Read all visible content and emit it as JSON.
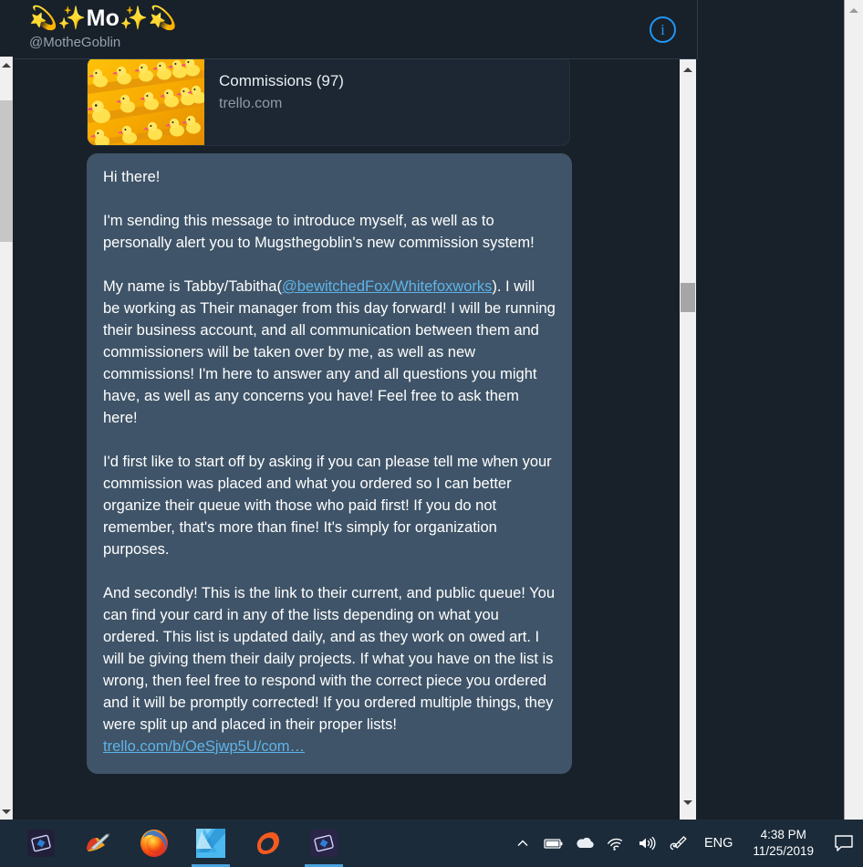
{
  "window": {
    "background_color": "#182029",
    "bubble_color": "#3f5468",
    "accent_color": "#2196f3",
    "link_color": "#5fb3e8"
  },
  "header": {
    "display_name": "Mo",
    "emoji_left": "💫✨",
    "emoji_right": "✨💫",
    "handle": "@MotheGoblin",
    "info_glyph": "i",
    "info_label": "Conversation info"
  },
  "link_preview": {
    "title": "Commissions (97)",
    "domain": "trello.com",
    "thumbnail_alt": "rows of yellow rubber ducks"
  },
  "message": {
    "paragraphs": [
      "Hi there!",
      "I'm sending this message to introduce myself, as well as to personally alert you to Mugsthegoblin's new commission system!",
      "I'd first like to start off by asking if you can please tell me when your commission was placed and what you ordered so I can better organize their queue with those who paid first! If you do not remember, that's more than fine! It's simply for organization purposes."
    ],
    "name_para_prefix": "My name is Tabby/Tabitha(",
    "name_para_link": "@bewitchedFox/Whitefoxworks",
    "name_para_suffix": "). I will be working as Their manager from this day forward! I will be running their business account, and all communication between them and commissioners will be taken over by me, as well as new commissions! I'm here to answer any and all questions you might have, as well as any concerns you have! Feel free to ask them here!",
    "final_para": "And secondly! This is the link to their current, and public queue! You can find your card in any of the lists depending on what you ordered. This list is updated daily, and as they work on owed art. I will be giving them their daily projects. If what you have on the list is wrong, then feel free to respond with the correct piece you ordered and it will be promptly corrected! If you ordered multiple things, they were split up and placed in their proper lists!",
    "trello_link": "trello.com/b/OeSjwp5U/com…"
  },
  "taskbar": {
    "apps": [
      {
        "name": "clip-studio-paint",
        "label": "Clip Studio Paint",
        "active": false
      },
      {
        "name": "paint-tool-sai",
        "label": "Paint Tool SAI",
        "active": false
      },
      {
        "name": "firefox",
        "label": "Mozilla Firefox",
        "active": false
      },
      {
        "name": "affinity-designer",
        "label": "Affinity Designer",
        "active": true
      },
      {
        "name": "origin",
        "label": "Origin",
        "active": false
      },
      {
        "name": "clip-studio-paint-2",
        "label": "Clip Studio Paint",
        "active": true
      }
    ],
    "tray": {
      "show_hidden_icons": "Show hidden icons",
      "battery": "Battery",
      "onedrive": "OneDrive",
      "network": "Network",
      "volume": "Speakers",
      "pen": "Pen and Windows Ink",
      "language": "ENG",
      "time": "4:38 PM",
      "date": "11/25/2019",
      "action_center": "Action Center"
    }
  },
  "scrollbars": {
    "left_window": "window-vertical-scrollbar",
    "chat": "chat-vertical-scrollbar",
    "right_window": "page-vertical-scrollbar"
  }
}
